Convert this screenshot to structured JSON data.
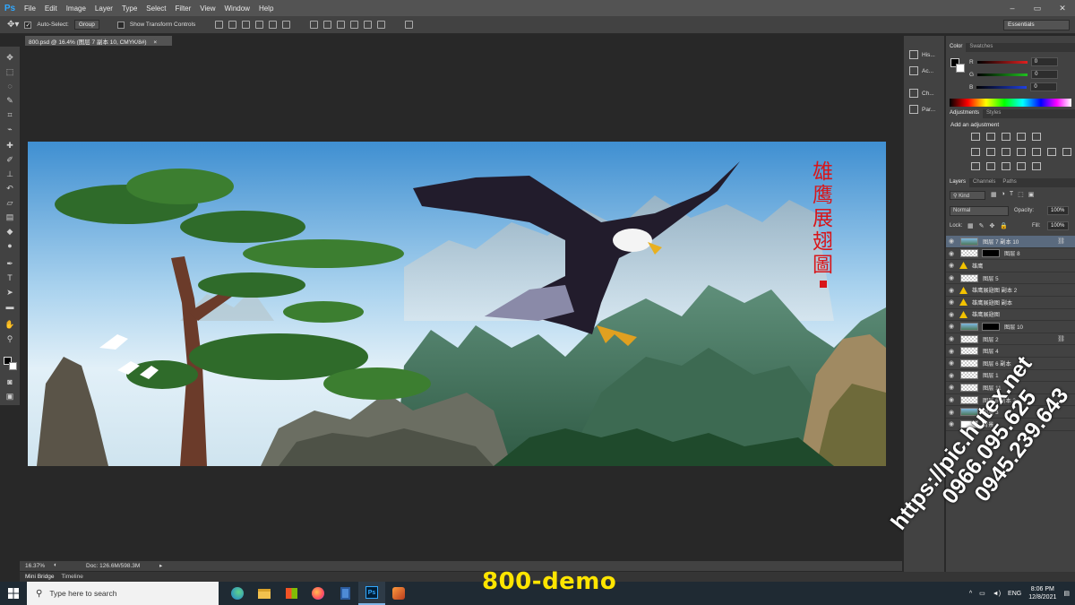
{
  "app": {
    "logo": "Ps"
  },
  "menu": [
    "File",
    "Edit",
    "Image",
    "Layer",
    "Type",
    "Select",
    "Filter",
    "View",
    "Window",
    "Help"
  ],
  "options_bar": {
    "auto_select_label": "Auto-Select:",
    "auto_select_value": "Group",
    "transform_label": "Show Transform Controls",
    "workspace": "Essentials"
  },
  "document": {
    "tab_title": "800.psd @ 16.4% (图层 7 副本 10, CMYK/8#)",
    "zoom": "16.37%",
    "doc_size": "Doc: 126.6M/598.3M"
  },
  "artwork": {
    "vertical_title": [
      "雄",
      "鹰",
      "展",
      "翅",
      "圖"
    ]
  },
  "bottom_tabs": [
    "Mini Bridge",
    "Timeline"
  ],
  "icon_strip": [
    {
      "label": "His...",
      "icon": "history-icon"
    },
    {
      "label": "Ac...",
      "icon": "actions-icon"
    },
    {
      "label": "Ch...",
      "icon": "character-icon"
    },
    {
      "label": "Par...",
      "icon": "paragraph-icon"
    }
  ],
  "color_panel": {
    "tabs": [
      "Color",
      "Swatches"
    ],
    "sliders": [
      {
        "label": "R",
        "value": "0",
        "color": "#e02020"
      },
      {
        "label": "G",
        "value": "0",
        "color": "#20c020"
      },
      {
        "label": "B",
        "value": "0",
        "color": "#2040e0"
      }
    ]
  },
  "adjustments_panel": {
    "tabs": [
      "Adjustments",
      "Styles"
    ],
    "heading": "Add an adjustment"
  },
  "layers_panel": {
    "tabs": [
      "Layers",
      "Channels",
      "Paths"
    ],
    "filter_kind": "Kind",
    "blend_mode": "Normal",
    "opacity_label": "Opacity:",
    "opacity_value": "100%",
    "lock_label": "Lock:",
    "fill_label": "Fill:",
    "fill_value": "100%",
    "layers": [
      {
        "name": "图层 7 副本 10",
        "thumb": "image",
        "selected": true,
        "linked": true
      },
      {
        "name": "图层 8",
        "thumb": "checker",
        "mask": true
      },
      {
        "name": "雄鹰",
        "warning": true
      },
      {
        "name": "图层 5",
        "thumb": "checker"
      },
      {
        "name": "雄鹰展翅图 副本 2",
        "warning": true
      },
      {
        "name": "雄鹰展翅图 副本",
        "warning": true
      },
      {
        "name": "雄鹰展翅图",
        "warning": true
      },
      {
        "name": "图层 10",
        "thumb": "image",
        "mask": true
      },
      {
        "name": "图层 2",
        "thumb": "checker",
        "linked": true
      },
      {
        "name": "图层 4",
        "thumb": "checker"
      },
      {
        "name": "图层 6 副本",
        "thumb": "checker"
      },
      {
        "name": "图层 1",
        "thumb": "checker"
      },
      {
        "name": "图层 11",
        "thumb": "checker"
      },
      {
        "name": "图层 6 副本 2",
        "thumb": "checker"
      },
      {
        "name": "图层 3",
        "thumb": "image"
      },
      {
        "name": "背景",
        "thumb": "white"
      }
    ]
  },
  "taskbar": {
    "search_placeholder": "Type here to search",
    "apps": [
      "edge-icon",
      "file-explorer-icon",
      "store-icon",
      "firefox-icon",
      "calculator-icon",
      "photoshop-icon",
      "app-icon"
    ],
    "language": "ENG",
    "time": "8:06 PM",
    "date": "12/8/2021"
  },
  "overlay": {
    "demo_label": "800-demo",
    "watermark_lines": [
      "https://pic.hutex.net",
      "0966.095.625",
      "0945.239.643"
    ]
  }
}
